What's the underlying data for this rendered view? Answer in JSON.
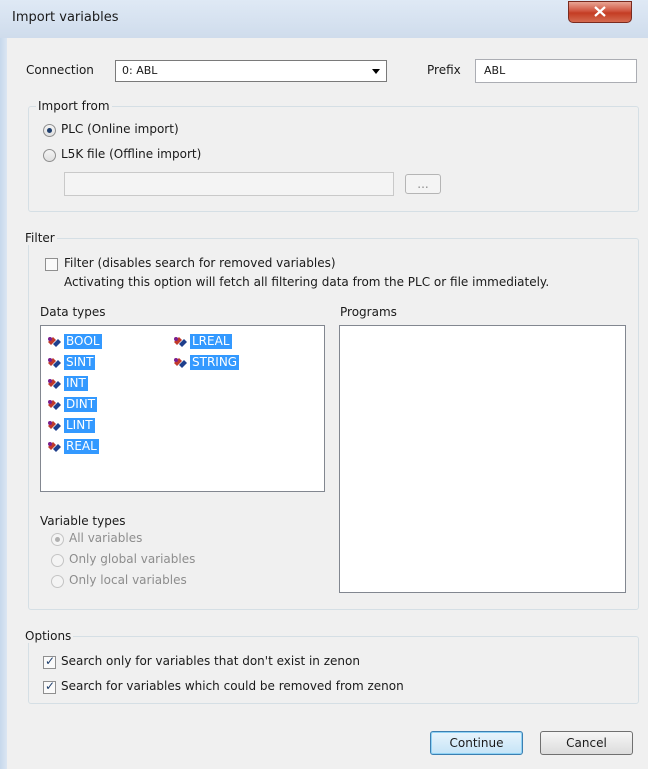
{
  "window": {
    "title": "Import variables"
  },
  "connection": {
    "label": "Connection",
    "value": "0: ABL"
  },
  "prefix": {
    "label": "Prefix",
    "value": "ABL"
  },
  "import_from": {
    "title": "Import from",
    "plc_option": "PLC (Online import)",
    "l5k_option": "L5K file (Offline import)",
    "file_path": "",
    "browse_label": "..."
  },
  "filter": {
    "title": "Filter",
    "checkbox_label": "Filter (disables search for removed variables)",
    "note": "Activating this option will fetch all filtering data from the PLC or file immediately.",
    "data_types_label": "Data types",
    "programs_label": "Programs",
    "data_types": [
      "BOOL",
      "SINT",
      "INT",
      "DINT",
      "LINT",
      "REAL",
      "LREAL",
      "STRING"
    ],
    "variable_types": {
      "title": "Variable types",
      "all": "All variables",
      "global": "Only global variables",
      "local": "Only local variables"
    }
  },
  "options": {
    "title": "Options",
    "search_nonexisting": "Search only for variables that don't exist in zenon",
    "search_removed": "Search for variables which could be removed from zenon"
  },
  "buttons": {
    "continue": "Continue",
    "cancel": "Cancel"
  },
  "colors": {
    "selection": "#3399ff",
    "close_button": "#c43c23"
  }
}
